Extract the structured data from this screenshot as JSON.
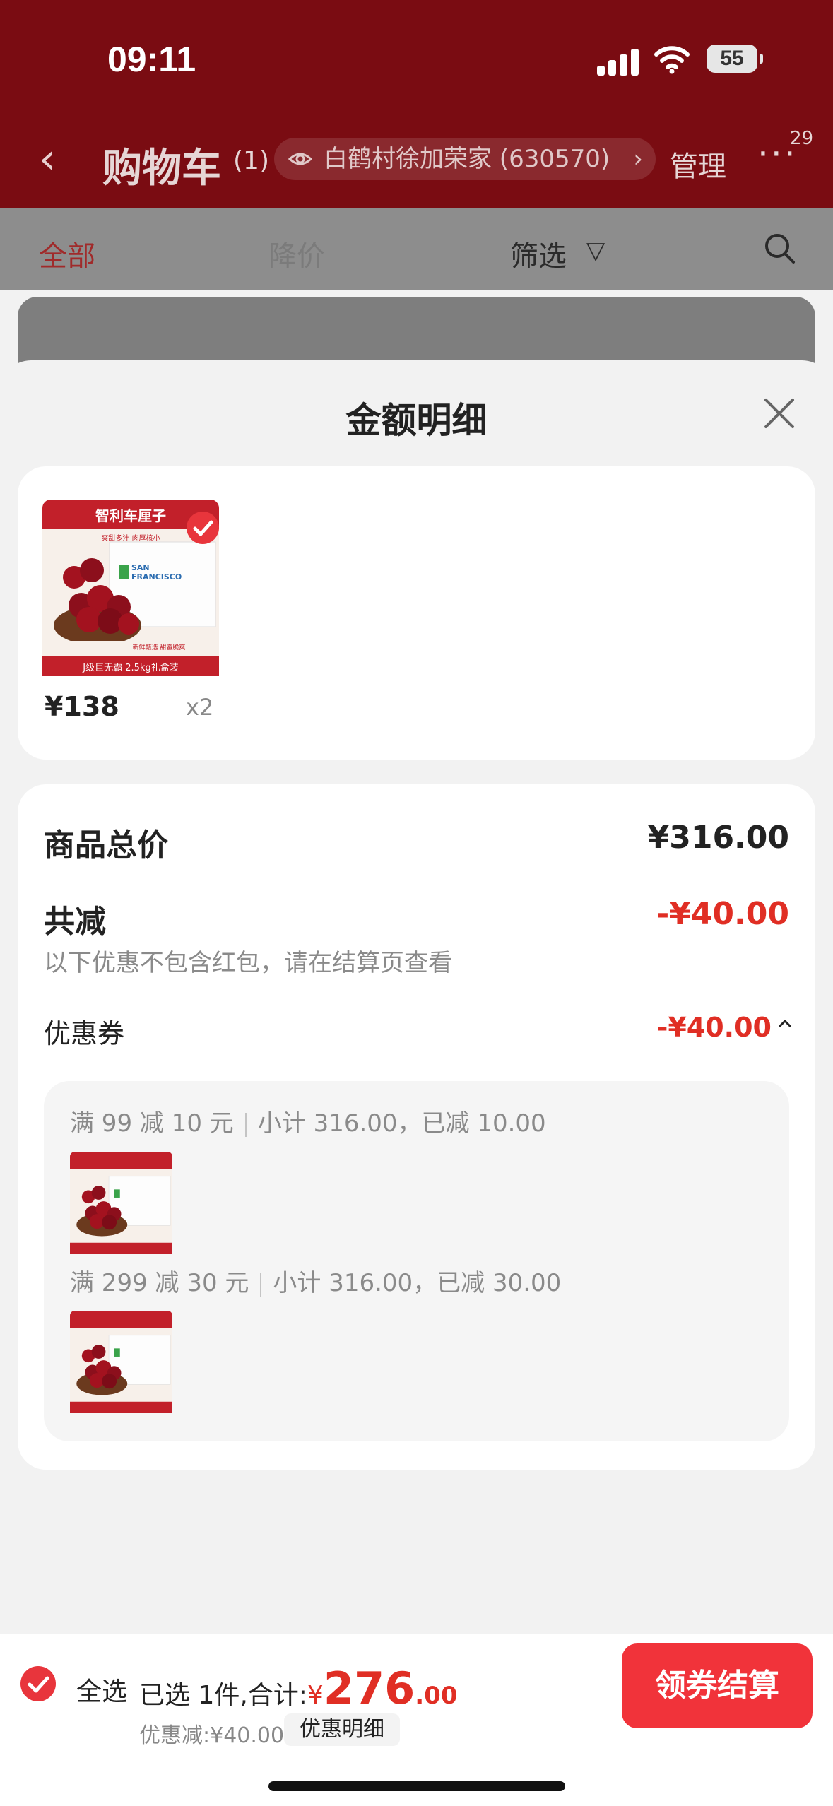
{
  "status": {
    "time": "09:11",
    "battery": "55"
  },
  "nav": {
    "back": "‹",
    "title": "购物车",
    "count": "(1)",
    "address": "白鹤村徐加荣家 (630570)",
    "address_chevron": "›",
    "manage": "管理",
    "more": "···",
    "badge": "29"
  },
  "filters": {
    "all": "全部",
    "price_drop": "降价",
    "filter": "筛选",
    "funnel": "▽"
  },
  "sheet": {
    "title": "金额明细",
    "product": {
      "price": "¥138",
      "qty": "x2"
    },
    "total_label": "商品总价",
    "total_value": "¥316.00",
    "reduce_label": "共减",
    "reduce_value": "-¥40.00",
    "hint": "以下优惠不包含红包，请在结算页查看",
    "coupon_label": "优惠券",
    "coupon_value": "-¥40.00",
    "rules": [
      {
        "rule": "满 99 减 10 元",
        "detail": "小计 316.00，已减 10.00"
      },
      {
        "rule": "满 299 减 30 元",
        "detail": "小计 316.00，已减 30.00"
      }
    ]
  },
  "product_image_text": {
    "top": "智利车厘子",
    "sub": "爽甜多汁 肉厚核小",
    "brand": "SAN FRANCISCO",
    "bottom": "J级巨无霸 2.5kg礼盒装"
  },
  "bottom": {
    "select_all": "全选",
    "selected_prefix": "已选 1件,合计:",
    "currency": "¥",
    "total_int": "276",
    "total_dec": ".00",
    "discount": "优惠减:¥40.00",
    "detail_link": "优惠明细",
    "checkout": "领券结算"
  },
  "colors": {
    "accent": "#e02e24",
    "button": "#f1333a",
    "header_dim": "#7a0c12"
  }
}
